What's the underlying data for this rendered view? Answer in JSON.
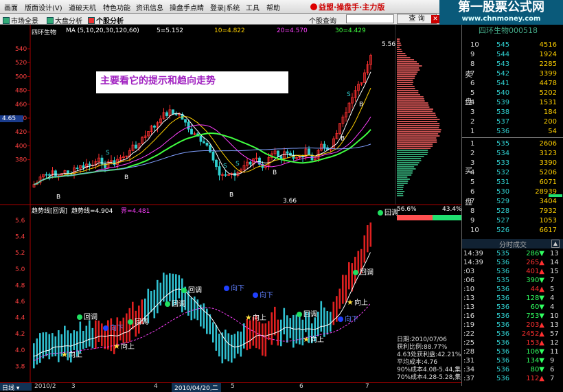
{
  "menu": [
    "画面",
    "版面设计(V)",
    "道破天机",
    "特色功能",
    "资讯信息",
    "操盘手点睛",
    "登录|系统",
    "工具",
    "帮助"
  ],
  "brand": "益盟·操盘手·主力版",
  "site_banner": {
    "title": "第一股票公式网",
    "url": "www.chnmoney.com"
  },
  "toolbar": {
    "market": "市场全景",
    "analysis": "大盘分析",
    "stock": "个股分析",
    "search_label": "个股查询",
    "query": "查 询"
  },
  "stock_title": "四环生物000518",
  "ma_legend": {
    "name": "四环生物",
    "ma": "MA (5,10,20,30,120,60)",
    "ma5": "5=5.152",
    "ma10": "10=4.822",
    "ma20": "20=4.570",
    "ma30": "30=4.429"
  },
  "note": "主要看它的提示和趋向走势",
  "price_axis": [
    "540",
    "520",
    "500",
    "480",
    "460",
    "440",
    "420",
    "400",
    "380"
  ],
  "current_price_tag": "4.65",
  "high_label": "5.56",
  "low_label": "3.66",
  "trend_legend": {
    "title": "趋势线[回调]",
    "value": "趋势线=4.904",
    "prev": "界=4.481"
  },
  "trend_axis": [
    "5.6",
    "5.4",
    "5.2",
    "5.0",
    "4.8",
    "4.6",
    "4.4",
    "4.2",
    "4.0",
    "3.8"
  ],
  "signals": {
    "pullback": "回调",
    "up": "向上",
    "down": "向下",
    "buy": "B",
    "sell": "S"
  },
  "profit_bar": {
    "left": "56.6%",
    "right": "43.4%"
  },
  "dates": [
    "2010/2",
    "3",
    "4",
    "2010/04/20,二",
    "5",
    "6",
    "7"
  ],
  "day_tab": "日线",
  "cost_info": [
    "日期:2010/07/06",
    "获利比例:88.77%",
    "4.63处获利盘:42.21%",
    "平均成本:4.76",
    "90%成本4.08-5.44,集",
    "70%成本4.28-5.28,集"
  ],
  "order_book": {
    "sell_label": [
      "卖",
      "盘"
    ],
    "buy_label": [
      "买",
      "盘"
    ],
    "sell": [
      {
        "lvl": "10",
        "price": "545",
        "vol": "4516"
      },
      {
        "lvl": "9",
        "price": "544",
        "vol": "1924"
      },
      {
        "lvl": "8",
        "price": "543",
        "vol": "2285"
      },
      {
        "lvl": "7",
        "price": "542",
        "vol": "3399"
      },
      {
        "lvl": "6",
        "price": "541",
        "vol": "4478"
      },
      {
        "lvl": "5",
        "price": "540",
        "vol": "5202"
      },
      {
        "lvl": "4",
        "price": "539",
        "vol": "1531"
      },
      {
        "lvl": "3",
        "price": "538",
        "vol": "184"
      },
      {
        "lvl": "2",
        "price": "537",
        "vol": "200"
      },
      {
        "lvl": "1",
        "price": "536",
        "vol": "54"
      }
    ],
    "buy": [
      {
        "lvl": "1",
        "price": "535",
        "vol": "2606"
      },
      {
        "lvl": "2",
        "price": "534",
        "vol": "3123"
      },
      {
        "lvl": "3",
        "price": "533",
        "vol": "3390"
      },
      {
        "lvl": "4",
        "price": "532",
        "vol": "5206"
      },
      {
        "lvl": "5",
        "price": "531",
        "vol": "6071"
      },
      {
        "lvl": "6",
        "price": "530",
        "vol": "28939"
      },
      {
        "lvl": "7",
        "price": "529",
        "vol": "3404"
      },
      {
        "lvl": "8",
        "price": "528",
        "vol": "7932"
      },
      {
        "lvl": "9",
        "price": "527",
        "vol": "1053"
      },
      {
        "lvl": "10",
        "price": "526",
        "vol": "6617"
      }
    ]
  },
  "ticks_header": "分时成交",
  "ticks": [
    {
      "t": "14:39",
      "p": "535",
      "v": "286",
      "d": "down",
      "n": "13"
    },
    {
      "t": "14:39",
      "p": "536",
      "v": "265",
      "d": "up",
      "n": "14"
    },
    {
      "t": ":03",
      "p": "536",
      "v": "401",
      "d": "up",
      "n": "15"
    },
    {
      "t": ":06",
      "p": "535",
      "v": "390",
      "d": "down",
      "n": "7"
    },
    {
      "t": ":10",
      "p": "536",
      "v": "44",
      "d": "up",
      "n": "5"
    },
    {
      "t": ":13",
      "p": "536",
      "v": "128",
      "d": "down",
      "n": "4"
    },
    {
      "t": ":13",
      "p": "536",
      "v": "60",
      "d": "down",
      "n": "4"
    },
    {
      "t": ":16",
      "p": "536",
      "v": "753",
      "d": "down",
      "n": "10"
    },
    {
      "t": ":19",
      "p": "536",
      "v": "203",
      "d": "up",
      "n": "13"
    },
    {
      "t": ":22",
      "p": "536",
      "v": "2452",
      "d": "up",
      "n": "57"
    },
    {
      "t": ":25",
      "p": "536",
      "v": "153",
      "d": "up",
      "n": "12"
    },
    {
      "t": ":28",
      "p": "536",
      "v": "106",
      "d": "down",
      "n": "11"
    },
    {
      "t": ":31",
      "p": "536",
      "v": "134",
      "d": "down",
      "n": "9"
    },
    {
      "t": ":34",
      "p": "536",
      "v": "80",
      "d": "down",
      "n": "6"
    },
    {
      "t": ":37",
      "p": "536",
      "v": "112",
      "d": "up",
      "n": "7"
    }
  ],
  "colors": {
    "up": "#ff3030",
    "down": "#30d0d0",
    "ma5": "#ffffff",
    "ma10": "#ffd000",
    "ma20": "#ff40ff",
    "ma30": "#40ff40",
    "ma60": "#80a0ff"
  }
}
